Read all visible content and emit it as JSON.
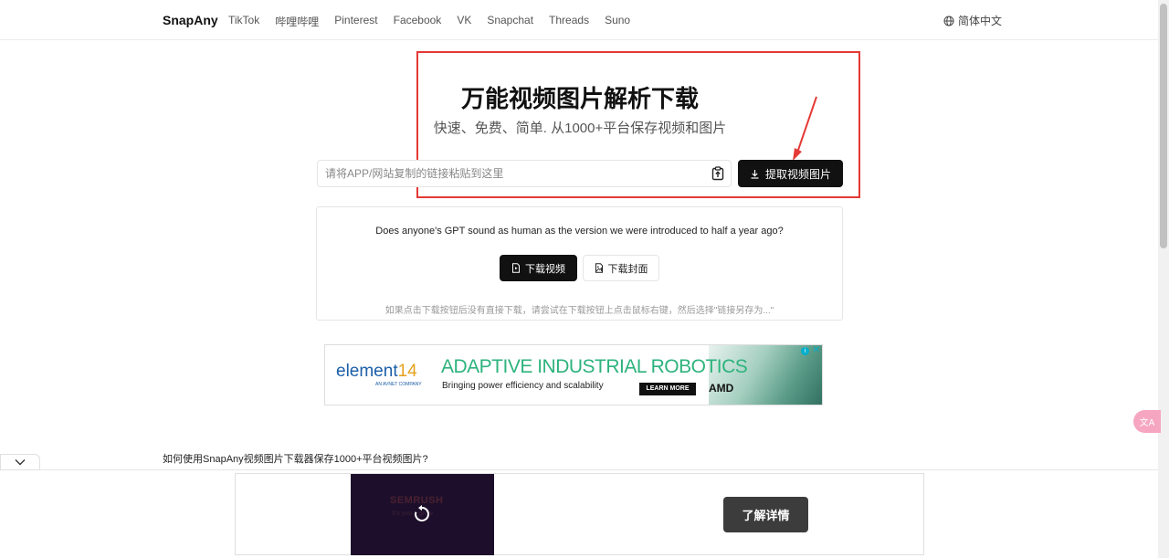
{
  "nav": {
    "brand": "SnapAny",
    "links": [
      "TikTok",
      "哔哩哔哩",
      "Pinterest",
      "Facebook",
      "VK",
      "Snapchat",
      "Threads",
      "Suno"
    ],
    "language": "简体中文"
  },
  "hero": {
    "title": "万能视频图片解析下载",
    "subtitle": "快速、免费、简单. 从1000+平台保存视频和图片"
  },
  "search": {
    "placeholder": "请将APP/网站复制的链接粘贴到这里",
    "value": "",
    "extract_label": "提取视频图片"
  },
  "result": {
    "question": "Does anyone's GPT sound as human as the version we were introduced to half a year ago?",
    "download_video_label": "下载视频",
    "download_cover_label": "下载封面",
    "hint": "如果点击下载按钮后没有直接下载，请尝试在下载按钮上点击鼠标右键，然后选择\"链接另存为...\""
  },
  "ad_banner": {
    "logo_main": "element",
    "logo_num": "14",
    "logo_sub": "AN AVNET COMPANY",
    "headline": "ADAPTIVE INDUSTRIAL ROBOTICS",
    "tagline": "Bringing power efficiency and scalability",
    "cta": "LEARN MORE",
    "sponsor": "AMD"
  },
  "faq": {
    "heading": "如何使用SnapAny视频图片下载器保存1000+平台视频图片?"
  },
  "bottom_ad": {
    "brand": "SEMRUSH",
    "slogan": "It's you... grow.",
    "cta": "了解详情"
  },
  "colors": {
    "accent": "#111111",
    "highlight_box": "#e53935",
    "ad_green": "#2db37d",
    "ad_blue": "#1b5ea8",
    "translate_fab": "#f6a6c0"
  }
}
